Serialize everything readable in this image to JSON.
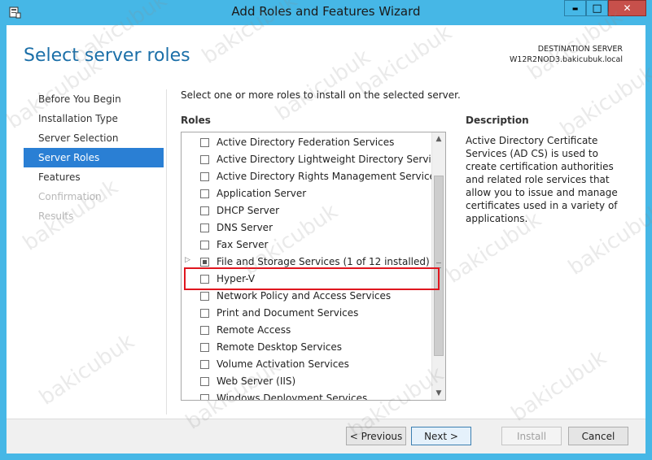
{
  "window": {
    "title": "Add Roles and Features Wizard",
    "controls": {
      "minimize": "▬",
      "maximize": "□",
      "close": "✕"
    }
  },
  "page_title": "Select server roles",
  "destination": {
    "label": "DESTINATION SERVER",
    "server": "W12R2NOD3.bakicubuk.local"
  },
  "nav": {
    "items": [
      {
        "label": "Before You Begin",
        "state": "normal"
      },
      {
        "label": "Installation Type",
        "state": "normal"
      },
      {
        "label": "Server Selection",
        "state": "normal"
      },
      {
        "label": "Server Roles",
        "state": "selected"
      },
      {
        "label": "Features",
        "state": "normal"
      },
      {
        "label": "Confirmation",
        "state": "disabled"
      },
      {
        "label": "Results",
        "state": "disabled"
      }
    ]
  },
  "instruction": "Select one or more roles to install on the selected server.",
  "roles": {
    "label": "Roles",
    "items": [
      {
        "label": "Active Directory Federation Services",
        "checked": false
      },
      {
        "label": "Active Directory Lightweight Directory Services",
        "checked": false
      },
      {
        "label": "Active Directory Rights Management Services",
        "checked": false
      },
      {
        "label": "Application Server",
        "checked": false
      },
      {
        "label": "DHCP Server",
        "checked": false
      },
      {
        "label": "DNS Server",
        "checked": false
      },
      {
        "label": "Fax Server",
        "checked": false
      },
      {
        "label": "File and Storage Services (1 of 12 installed)",
        "checked": "partial",
        "expandable": true
      },
      {
        "label": "Hyper-V",
        "checked": false,
        "highlighted": true
      },
      {
        "label": "Network Policy and Access Services",
        "checked": false
      },
      {
        "label": "Print and Document Services",
        "checked": false
      },
      {
        "label": "Remote Access",
        "checked": false
      },
      {
        "label": "Remote Desktop Services",
        "checked": false
      },
      {
        "label": "Volume Activation Services",
        "checked": false
      },
      {
        "label": "Web Server (IIS)",
        "checked": false
      },
      {
        "label": "Windows Deployment Services",
        "checked": false
      }
    ]
  },
  "description": {
    "title": "Description",
    "text": "Active Directory Certificate Services (AD CS) is used to create certification authorities and related role services that allow you to issue and manage certificates used in a variety of applications."
  },
  "buttons": {
    "previous": "< Previous",
    "next": "Next >",
    "install": "Install",
    "cancel": "Cancel"
  },
  "watermark": "bakicubuk",
  "colors": {
    "frame": "#46b7e6",
    "accent": "#1b6fa8",
    "selected_nav": "#2a7fd4",
    "highlight": "#e0161f"
  }
}
